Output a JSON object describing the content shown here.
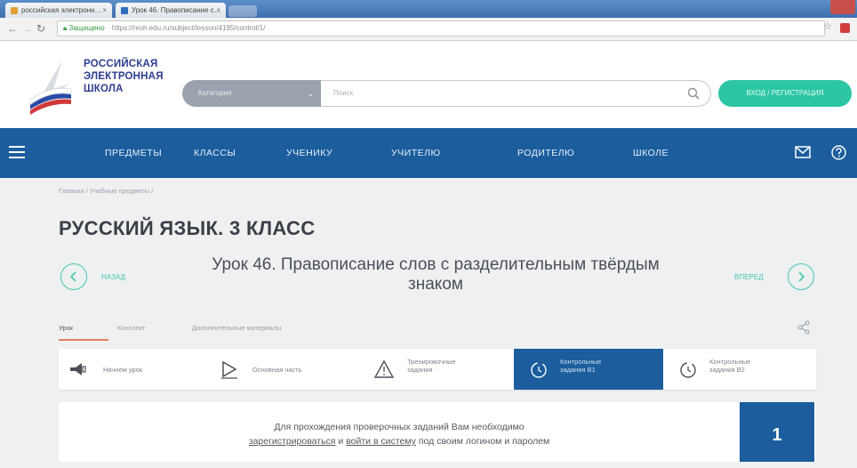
{
  "browser": {
    "tabs": [
      {
        "label": "российская электронн…",
        "close": "×"
      },
      {
        "label": "Урок 46. Правописание с…",
        "close": "×"
      }
    ],
    "secure_label": "Защищено",
    "url": "https://resh.edu.ru/subject/lesson/4195/control/1/"
  },
  "header": {
    "logo_lines": [
      "РОССИЙСКАЯ",
      "ЭЛЕКТРОННАЯ",
      "ШКОЛА"
    ],
    "category_select": "Категория",
    "search_placeholder": "Поиск",
    "login_label": "ВХОД / РЕГИСТРАЦИЯ"
  },
  "nav": {
    "items": [
      "ПРЕДМЕТЫ",
      "КЛАССЫ",
      "УЧЕНИКУ",
      "УЧИТЕЛЮ",
      "РОДИТЕЛЮ",
      "ШКОЛЕ"
    ]
  },
  "content": {
    "breadcrumb": "Главная / Учебные предметы /",
    "page_title": "РУССКИЙ ЯЗЫК. 3 КЛАСС",
    "prev_label": "НАЗАД",
    "next_label": "ВПЕРЕД",
    "lesson_title_line1": "Урок 46. Правописание слов с разделительным твёрдым",
    "lesson_title_line2": "знаком",
    "tabs": [
      "Урок",
      "Конспект",
      "Дополнительные материалы"
    ],
    "steps": [
      {
        "line1": "Начнем урок",
        "line2": ""
      },
      {
        "line1": "Основная часть",
        "line2": ""
      },
      {
        "line1": "Тренировочные",
        "line2": "задания"
      },
      {
        "line1": "Контрольные",
        "line2": "задания В1"
      },
      {
        "line1": "Контрольные",
        "line2": "задания В2"
      }
    ],
    "active_step": 3,
    "notice_before": "Для прохождения проверочных заданий Вам необходимо",
    "notice_link1": "зарегистрироваться",
    "notice_and": " и ",
    "notice_link2": "войти в систему",
    "notice_after": " под своим логином и паролем",
    "task_number": "1"
  },
  "colors": {
    "nav_blue": "#1b5d9d",
    "accent_teal": "#2cc6a4",
    "tab_underline": "#e67e5a"
  },
  "icons": [
    "burger-menu-icon",
    "mail-icon",
    "help-icon",
    "search-icon",
    "share-icon",
    "prev-arrow-icon",
    "next-arrow-icon",
    "megaphone-icon",
    "play-icon",
    "triangle-warning-icon",
    "timer-icon"
  ]
}
